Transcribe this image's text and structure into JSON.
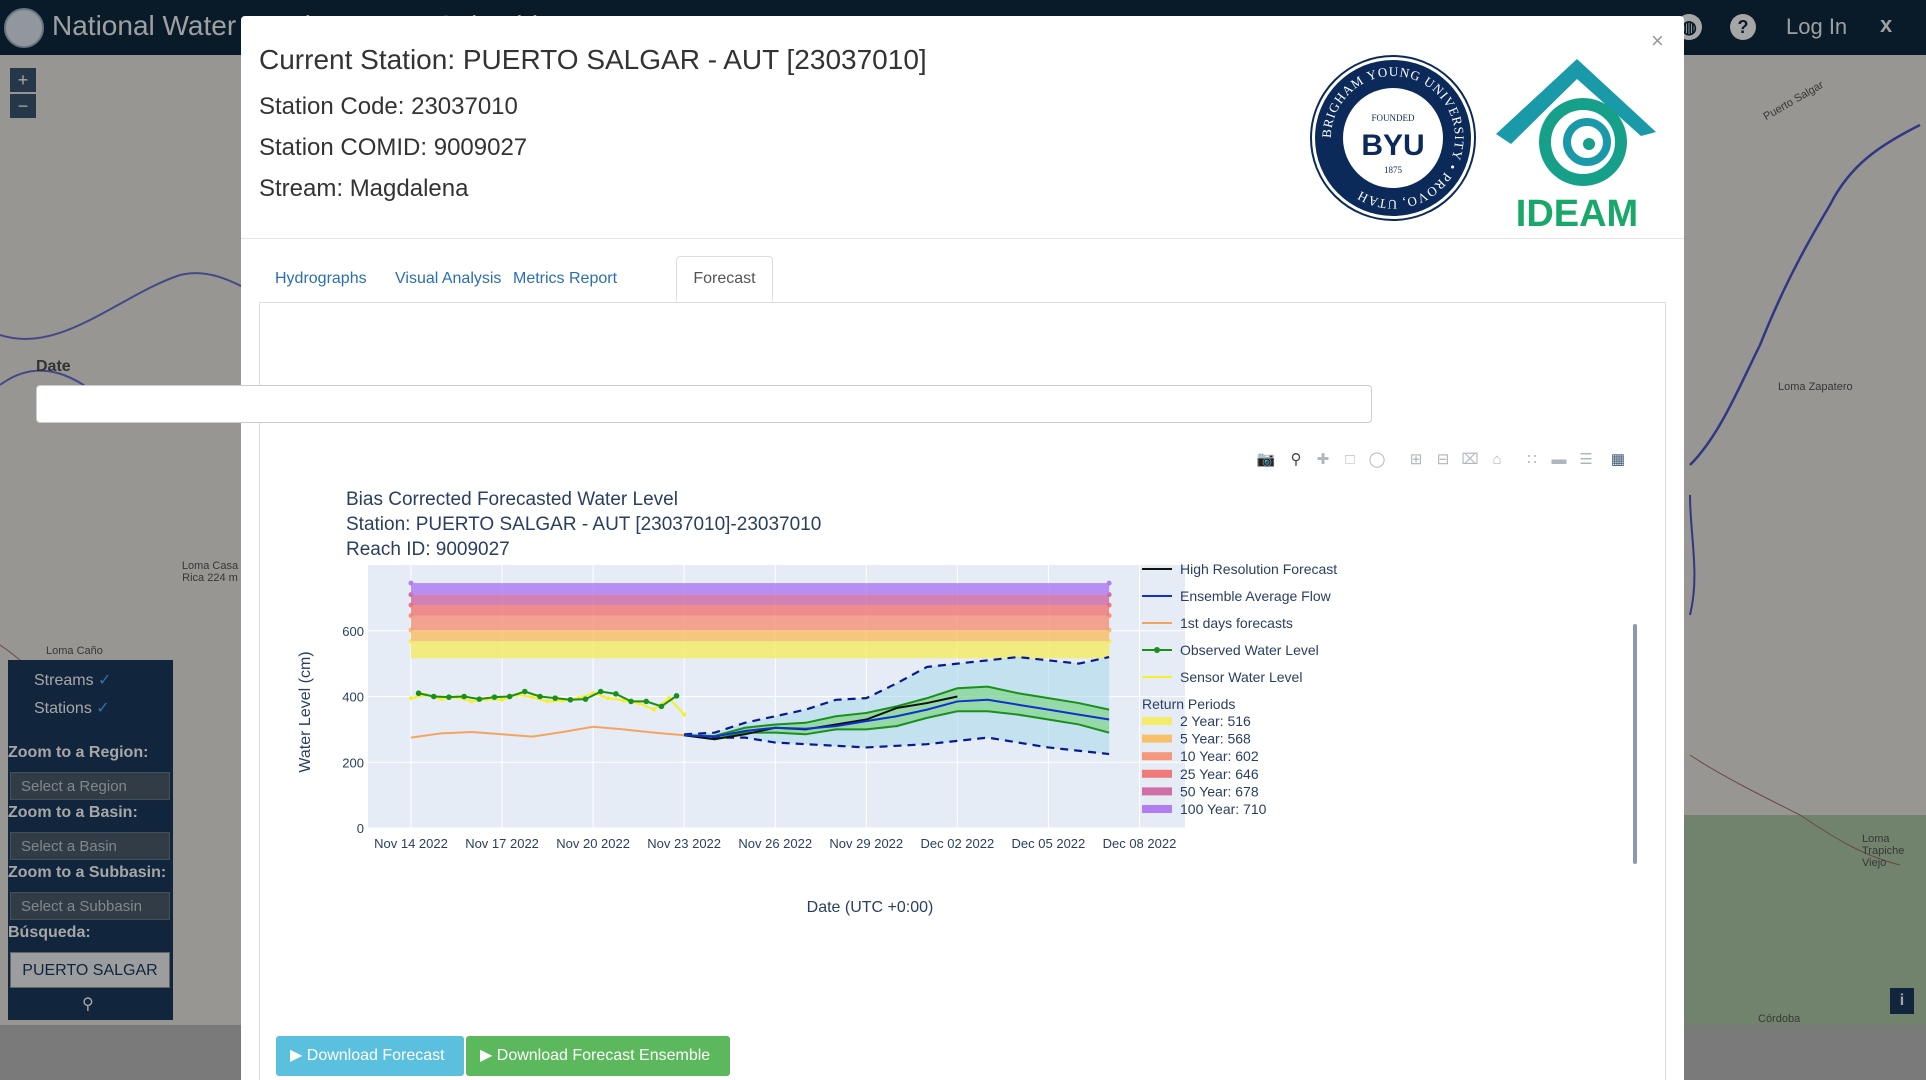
{
  "app": {
    "title": "National Water Level Forecast Colombia",
    "login_label": "Log In",
    "close_label": "x",
    "help_icon": "?",
    "globe_icon": "globe-icon"
  },
  "map": {
    "zoom_in": "+",
    "zoom_out": "−",
    "labels": [
      "Loma Zapatero",
      "Loma Casa Rica 224 m",
      "Loma Caño",
      "Puerto Salgar",
      "Loma Trapiche Viejo",
      "Córdoba"
    ],
    "info_label": "i"
  },
  "left_panel": {
    "streams_label": "Streams",
    "stations_label": "Stations",
    "check": "✓",
    "zoom_region_label": "Zoom to a Region:",
    "region_placeholder": "Select a Region",
    "zoom_basin_label": "Zoom to a Basin:",
    "basin_placeholder": "Select a Basin",
    "zoom_subbasin_label": "Zoom to a Subbasin:",
    "subbasin_placeholder": "Select a Subbasin",
    "search_label": "Búsqueda:",
    "search_value": "PUERTO SALGAR"
  },
  "modal": {
    "close": "×",
    "station_title": "Current Station: PUERTO SALGAR - AUT [23037010]",
    "station_code": "Station Code: 23037010",
    "station_comid": "Station COMID: 9009027",
    "stream": "Stream: Magdalena",
    "byu": {
      "ring_text": "BRIGHAM YOUNG UNIVERSITY • PROVO, UTAH",
      "founded": "FOUNDED",
      "name": "BYU",
      "year": "1875"
    },
    "ideam_label": "IDEAM",
    "tabs": [
      "Hydrographs",
      "Visual Analysis",
      "Metrics Report",
      "Forecast"
    ],
    "active_tab": "Forecast",
    "date_label": "Date",
    "date_value": "",
    "buttons": {
      "download_forecast": "Download Forecast",
      "download_ensemble": "Download Forecast Ensemble"
    }
  },
  "chart_data": {
    "type": "line",
    "title": "Bias Corrected Forecasted Water Level",
    "subtitle_1": "Station: PUERTO SALGAR - AUT [23037010]-23037010",
    "subtitle_2": "Reach ID: 9009027",
    "xlabel": "Date (UTC +0:00)",
    "ylabel": "Water Level (cm)",
    "xlim": [
      "2022-11-12T14:00",
      "2022-12-09T12:00"
    ],
    "ylim": [
      0,
      800
    ],
    "xticks": [
      "Nov 14 2022",
      "Nov 17 2022",
      "Nov 20 2022",
      "Nov 23 2022",
      "Nov 26 2022",
      "Nov 29 2022",
      "Dec 02 2022",
      "Dec 05 2022",
      "Dec 08 2022"
    ],
    "yticks": [
      0,
      200,
      400,
      600
    ],
    "legend_position": "right",
    "legend": [
      "High Resolution Forecast",
      "Ensemble Average Flow",
      "1st days forecasts",
      "Observed Water Level",
      "Sensor Water Level",
      "Return Periods",
      "2 Year: 516",
      "5 Year: 568",
      "10 Year: 602",
      "25 Year: 646",
      "50 Year: 678",
      "100 Year: 710"
    ],
    "return_periods": [
      {
        "name": "2 Year: 516",
        "from": 516,
        "to": 568,
        "color": "#f4eb6a"
      },
      {
        "name": "5 Year: 568",
        "from": 568,
        "to": 602,
        "color": "#f9c06a"
      },
      {
        "name": "10 Year: 602",
        "from": 602,
        "to": 646,
        "color": "#f4977c"
      },
      {
        "name": "25 Year: 646",
        "from": 646,
        "to": 678,
        "color": "#ef7a7a"
      },
      {
        "name": "50 Year: 678",
        "from": 678,
        "to": 710,
        "color": "#cf6fa6"
      },
      {
        "name": "100 Year: 710",
        "from": 710,
        "to": 745,
        "color": "#b07ef2"
      }
    ],
    "return_period_x": [
      "2022-11-14T00:00",
      "2022-12-07T00:00"
    ],
    "series": [
      {
        "name": "1st days forecasts",
        "color": "#f4a460",
        "x": [
          "2022-11-14T00:00",
          "2022-11-15T00:00",
          "2022-11-16T00:00",
          "2022-11-17T00:00",
          "2022-11-18T00:00",
          "2022-11-19T00:00",
          "2022-11-20T00:00",
          "2022-11-21T00:00",
          "2022-11-22T00:00",
          "2022-11-23T00:00"
        ],
        "y": [
          275,
          288,
          292,
          285,
          278,
          292,
          308,
          300,
          290,
          282
        ]
      },
      {
        "name": "Sensor Water Level",
        "color": "#f5ef2a",
        "x": [
          "2022-11-14T00:00",
          "2022-11-14T12:00",
          "2022-11-15T00:00",
          "2022-11-15T12:00",
          "2022-11-16T00:00",
          "2022-11-16T12:00",
          "2022-11-17T00:00",
          "2022-11-17T12:00",
          "2022-11-18T00:00",
          "2022-11-18T12:00",
          "2022-11-19T00:00",
          "2022-11-19T12:00",
          "2022-11-20T00:00",
          "2022-11-20T12:00",
          "2022-11-21T00:00",
          "2022-11-21T12:00",
          "2022-11-22T00:00",
          "2022-11-22T12:00",
          "2022-11-23T00:00"
        ],
        "y": [
          395,
          405,
          392,
          398,
          385,
          392,
          390,
          405,
          398,
          385,
          388,
          395,
          410,
          395,
          388,
          380,
          360,
          395,
          345
        ]
      },
      {
        "name": "Observed Water Level",
        "color": "#1a8f1a",
        "x": [
          "2022-11-14T06:00",
          "2022-11-14T18:00",
          "2022-11-15T06:00",
          "2022-11-15T18:00",
          "2022-11-16T06:00",
          "2022-11-16T18:00",
          "2022-11-17T06:00",
          "2022-11-17T18:00",
          "2022-11-18T06:00",
          "2022-11-18T18:00",
          "2022-11-19T06:00",
          "2022-11-19T18:00",
          "2022-11-20T06:00",
          "2022-11-20T18:00",
          "2022-11-21T06:00",
          "2022-11-21T18:00",
          "2022-11-22T06:00",
          "2022-11-22T18:00"
        ],
        "y": [
          410,
          400,
          398,
          400,
          392,
          398,
          400,
          415,
          400,
          395,
          390,
          392,
          415,
          408,
          385,
          385,
          370,
          402
        ]
      },
      {
        "name": "High Resolution Forecast",
        "color": "#111111",
        "x": [
          "2022-11-23T00:00",
          "2022-11-24T00:00",
          "2022-11-25T00:00",
          "2022-11-26T00:00",
          "2022-11-27T00:00",
          "2022-11-28T00:00",
          "2022-11-29T00:00",
          "2022-11-30T00:00",
          "2022-12-01T00:00",
          "2022-12-02T00:00"
        ],
        "y": [
          282,
          270,
          285,
          305,
          300,
          315,
          330,
          365,
          380,
          400
        ]
      },
      {
        "name": "Ensemble Average Flow",
        "color": "#1030d0",
        "x": [
          "2022-11-23T00:00",
          "2022-11-24T00:00",
          "2022-11-25T00:00",
          "2022-11-26T00:00",
          "2022-11-27T00:00",
          "2022-11-28T00:00",
          "2022-11-29T00:00",
          "2022-11-30T00:00",
          "2022-12-01T00:00",
          "2022-12-02T00:00",
          "2022-12-03T00:00",
          "2022-12-04T00:00",
          "2022-12-05T00:00",
          "2022-12-06T00:00",
          "2022-12-07T00:00"
        ],
        "y": [
          282,
          278,
          295,
          305,
          302,
          310,
          325,
          340,
          360,
          385,
          390,
          375,
          360,
          345,
          330
        ]
      }
    ],
    "ensemble_band": {
      "x": [
        "2022-11-23T00:00",
        "2022-11-24T00:00",
        "2022-11-25T00:00",
        "2022-11-26T00:00",
        "2022-11-27T00:00",
        "2022-11-28T00:00",
        "2022-11-29T00:00",
        "2022-11-30T00:00",
        "2022-12-01T00:00",
        "2022-12-02T00:00",
        "2022-12-03T00:00",
        "2022-12-04T00:00",
        "2022-12-05T00:00",
        "2022-12-06T00:00",
        "2022-12-07T00:00"
      ],
      "max": [
        285,
        290,
        320,
        340,
        360,
        390,
        395,
        440,
        490,
        500,
        510,
        520,
        510,
        500,
        520
      ],
      "p75": [
        282,
        280,
        305,
        315,
        320,
        340,
        350,
        370,
        395,
        425,
        430,
        410,
        395,
        380,
        360
      ],
      "p25": [
        282,
        270,
        290,
        290,
        285,
        300,
        300,
        310,
        335,
        355,
        355,
        345,
        330,
        315,
        290
      ],
      "min": [
        282,
        275,
        275,
        260,
        255,
        250,
        245,
        250,
        255,
        265,
        275,
        260,
        245,
        235,
        225
      ]
    }
  }
}
